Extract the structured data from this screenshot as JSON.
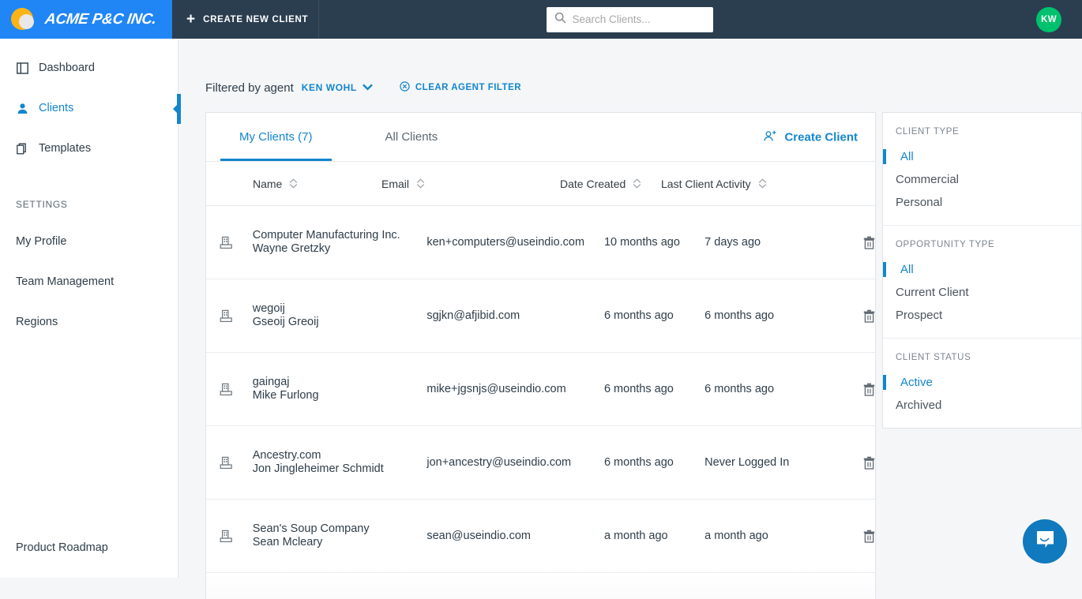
{
  "topbar": {
    "logo_text": "ACME P&C INC.",
    "create_new_label": "CREATE NEW CLIENT",
    "plus_icon": "plus-icon",
    "search": {
      "placeholder": "Search Clients...",
      "value": "",
      "icon": "search-icon"
    },
    "avatar_initials": "KW"
  },
  "sidebar": {
    "items": [
      {
        "label": "Dashboard",
        "icon": "dashboard-icon",
        "active": false
      },
      {
        "label": "Clients",
        "icon": "person-icon",
        "active": true
      },
      {
        "label": "Templates",
        "icon": "copy-icon",
        "active": false
      }
    ],
    "settings_heading": "SETTINGS",
    "settings_items": [
      {
        "label": "My Profile"
      },
      {
        "label": "Team Management"
      },
      {
        "label": "Regions"
      }
    ],
    "footer_link": "Product Roadmap"
  },
  "filter_bar": {
    "prefix_label": "Filtered by agent",
    "agent_name": "KEN WOHL",
    "chevron_icon": "chevron-down-icon",
    "clear_label": "CLEAR AGENT FILTER",
    "clear_icon": "circle-x-icon"
  },
  "clients_card": {
    "tabs": [
      {
        "label": "My Clients (7)",
        "active": true
      },
      {
        "label": "All Clients",
        "active": false
      }
    ],
    "create_client": {
      "label": "Create Client",
      "icon": "person-add-icon"
    },
    "columns": [
      {
        "label": "Name",
        "sort_icon": "sort-icon"
      },
      {
        "label": "Email",
        "sort_icon": "sort-icon"
      },
      {
        "label": "Date Created",
        "sort_icon": "sort-icon"
      },
      {
        "label": "Last Client Activity",
        "sort_icon": "sort-icon"
      }
    ],
    "rows": [
      {
        "icon": "building-icon",
        "company": "Computer Manufacturing Inc.",
        "contact": "Wayne Gretzky",
        "email": "ken+computers@useindio.com",
        "date_created": "10 months ago",
        "last_activity": "7 days ago",
        "delete_icon": "trash-icon"
      },
      {
        "icon": "building-icon",
        "company": "wegoij",
        "contact": "Gseoij Greoij",
        "email": "sgjkn@afjibid.com",
        "date_created": "6 months ago",
        "last_activity": "6 months ago",
        "delete_icon": "trash-icon"
      },
      {
        "icon": "building-icon",
        "company": "gaingaj",
        "contact": "Mike Furlong",
        "email": "mike+jgsnjs@useindio.com",
        "date_created": "6 months ago",
        "last_activity": "6 months ago",
        "delete_icon": "trash-icon"
      },
      {
        "icon": "building-icon",
        "company": "Ancestry.com",
        "contact": "Jon Jingleheimer Schmidt",
        "email": "jon+ancestry@useindio.com",
        "date_created": "6 months ago",
        "last_activity": "Never Logged In",
        "delete_icon": "trash-icon"
      },
      {
        "icon": "building-icon",
        "company": "Sean's Soup Company",
        "contact": "Sean Mcleary",
        "email": "sean@useindio.com",
        "date_created": "a month ago",
        "last_activity": "a month ago",
        "delete_icon": "trash-icon"
      }
    ]
  },
  "filter_panel": {
    "groups": [
      {
        "title": "CLIENT TYPE",
        "options": [
          {
            "label": "All",
            "selected": true
          },
          {
            "label": "Commercial",
            "selected": false
          },
          {
            "label": "Personal",
            "selected": false
          }
        ]
      },
      {
        "title": "OPPORTUNITY TYPE",
        "options": [
          {
            "label": "All",
            "selected": true
          },
          {
            "label": "Current Client",
            "selected": false
          },
          {
            "label": "Prospect",
            "selected": false
          }
        ]
      },
      {
        "title": "CLIENT STATUS",
        "options": [
          {
            "label": "Active",
            "selected": true
          },
          {
            "label": "Archived",
            "selected": false
          }
        ]
      }
    ]
  },
  "intercom": {
    "icon": "chat-bubble-icon"
  },
  "colors": {
    "topbar_bg": "#2b3e50",
    "logo_bg": "#2086f5",
    "accent_blue": "#1386cd",
    "avatar_green": "#00c16e",
    "logo_orange": "#fcb316",
    "intercom_blue": "#1179bd",
    "page_bg": "#f4f6f8"
  }
}
